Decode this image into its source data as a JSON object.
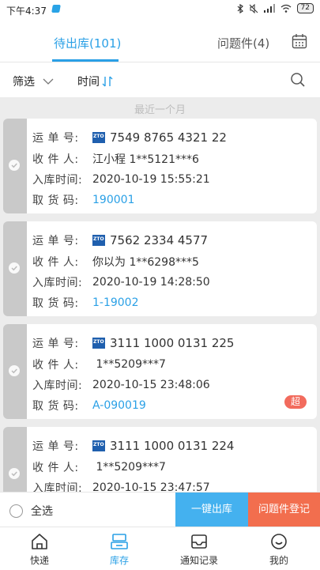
{
  "status_bar": {
    "time": "下午4:37",
    "battery": "72"
  },
  "tabs": {
    "pending": "待出库(101)",
    "issues": "问题件(4)"
  },
  "filter": {
    "filter_label": "筛选",
    "sort_label": "时间"
  },
  "section_title": "最近一个月",
  "labels": {
    "waybill": "运 单 号:",
    "recipient": "收 件 人:",
    "storage_time": "入库时间:",
    "pickup_code": "取 货 码:"
  },
  "parcels": [
    {
      "waybill": "7549 8765 4321 22",
      "recipient": "江小程 1**5121***6",
      "storage_time": "2020-10-19 15:55:21",
      "pickup_code": "190001"
    },
    {
      "waybill": "7562 2334 4577",
      "recipient": "你以为 1**6298***5",
      "storage_time": "2020-10-19 14:28:50",
      "pickup_code": "1-19002"
    },
    {
      "waybill": "3111 1000 0131 225",
      "recipient": " 1**5209***7",
      "storage_time": "2020-10-15 23:48:06",
      "pickup_code": "A-090019",
      "badge": "超"
    },
    {
      "waybill": "3111 1000 0131 224",
      "recipient": " 1**5209***7",
      "storage_time": "2020-10-15 23:47:57",
      "pickup_code": ""
    }
  ],
  "actions": {
    "select_all": "全选",
    "one_click_ship": "一键出库",
    "register_issue": "问题件登记"
  },
  "nav": [
    {
      "label": "快递",
      "icon": "home-icon"
    },
    {
      "label": "库存",
      "icon": "inventory-icon"
    },
    {
      "label": "通知记录",
      "icon": "message-icon"
    },
    {
      "label": "我的",
      "icon": "profile-icon"
    }
  ],
  "colors": {
    "accent": "#2aa0e6",
    "danger": "#f26e4e"
  }
}
